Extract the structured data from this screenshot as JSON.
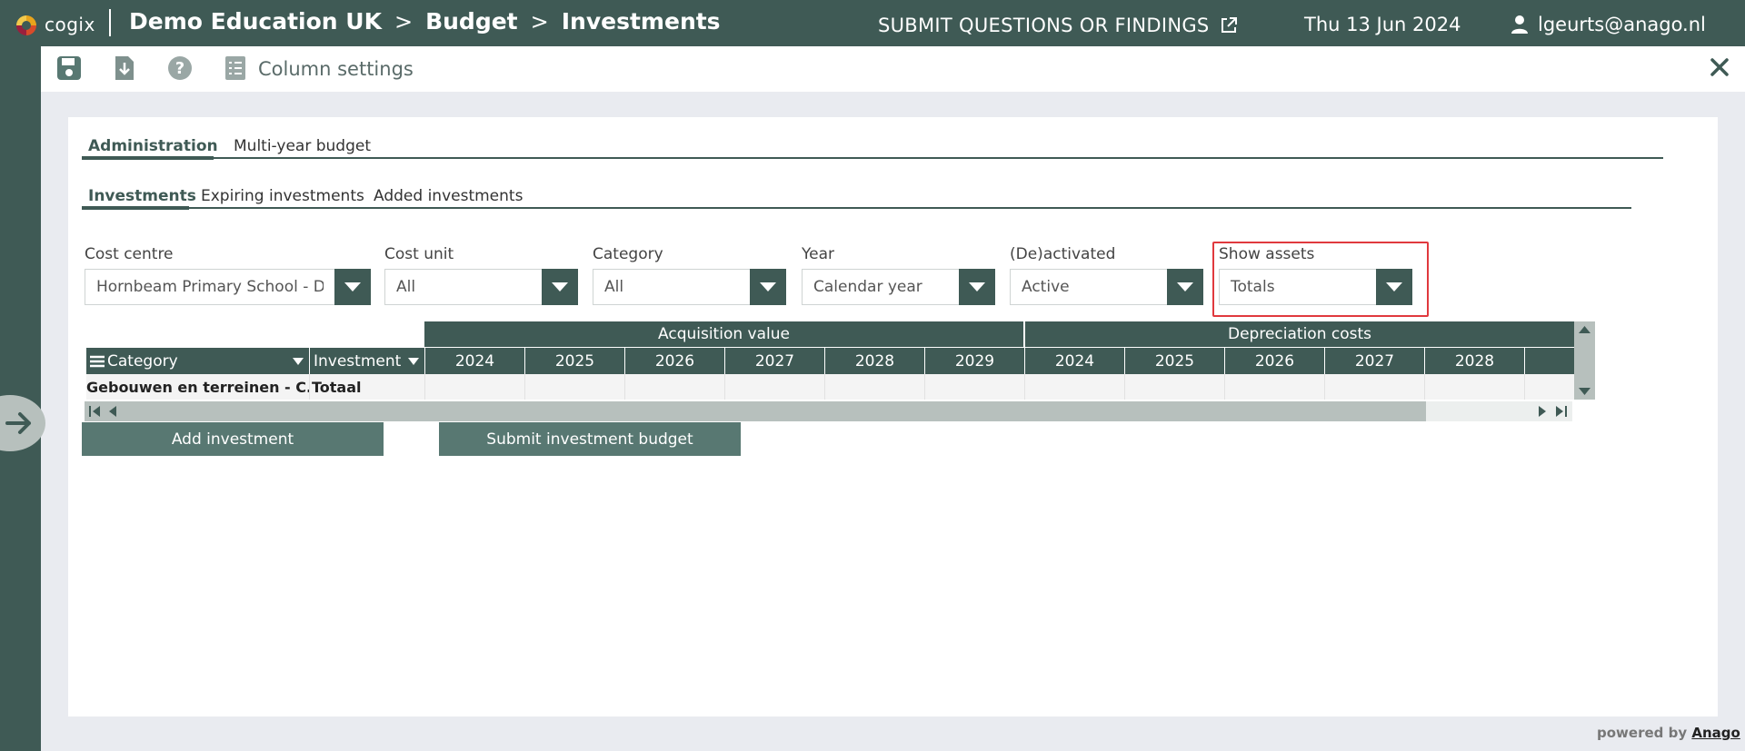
{
  "app": {
    "logo_text": "cogix"
  },
  "breadcrumb": [
    "Demo Education UK",
    "Budget",
    "Investments"
  ],
  "breadcrumb_sep": ">",
  "header": {
    "submit_label": "SUBMIT QUESTIONS OR FINDINGS",
    "date": "Thu 13 Jun 2024",
    "user": "lgeurts@anago.nl"
  },
  "toolbar": {
    "column_settings": "Column settings"
  },
  "tabs_primary": [
    {
      "label": "Administration",
      "active": true
    },
    {
      "label": "Multi-year budget",
      "active": false
    }
  ],
  "tabs_secondary": [
    {
      "label": "Investments",
      "active": true
    },
    {
      "label": "Expiring investments",
      "active": false
    },
    {
      "label": "Added investments",
      "active": false
    }
  ],
  "filters": [
    {
      "label": "Cost centre",
      "value": "Hornbeam Primary School - De"
    },
    {
      "label": "Cost unit",
      "value": "All"
    },
    {
      "label": "Category",
      "value": "All"
    },
    {
      "label": "Year",
      "value": "Calendar year"
    },
    {
      "label": "(De)activated",
      "value": "Active"
    },
    {
      "label": "Show assets",
      "value": "Totals"
    }
  ],
  "grid": {
    "groups": [
      "Acquisition value",
      "Depreciation costs"
    ],
    "col_category": "Category",
    "col_investment": "Investment",
    "years_acq": [
      "2024",
      "2025",
      "2026",
      "2027",
      "2028",
      "2029"
    ],
    "years_dep": [
      "2024",
      "2025",
      "2026",
      "2027",
      "2028"
    ],
    "row": {
      "category": "Gebouwen en terreinen - C...",
      "investment": "Totaal"
    }
  },
  "buttons": {
    "add_investment": "Add investment",
    "submit_budget": "Submit investment budget"
  },
  "footer": {
    "powered_by": "powered by",
    "brand": "Anago"
  },
  "colors": {
    "primary": "#3f5a55",
    "button": "#587872",
    "highlight": "#e0393e"
  }
}
